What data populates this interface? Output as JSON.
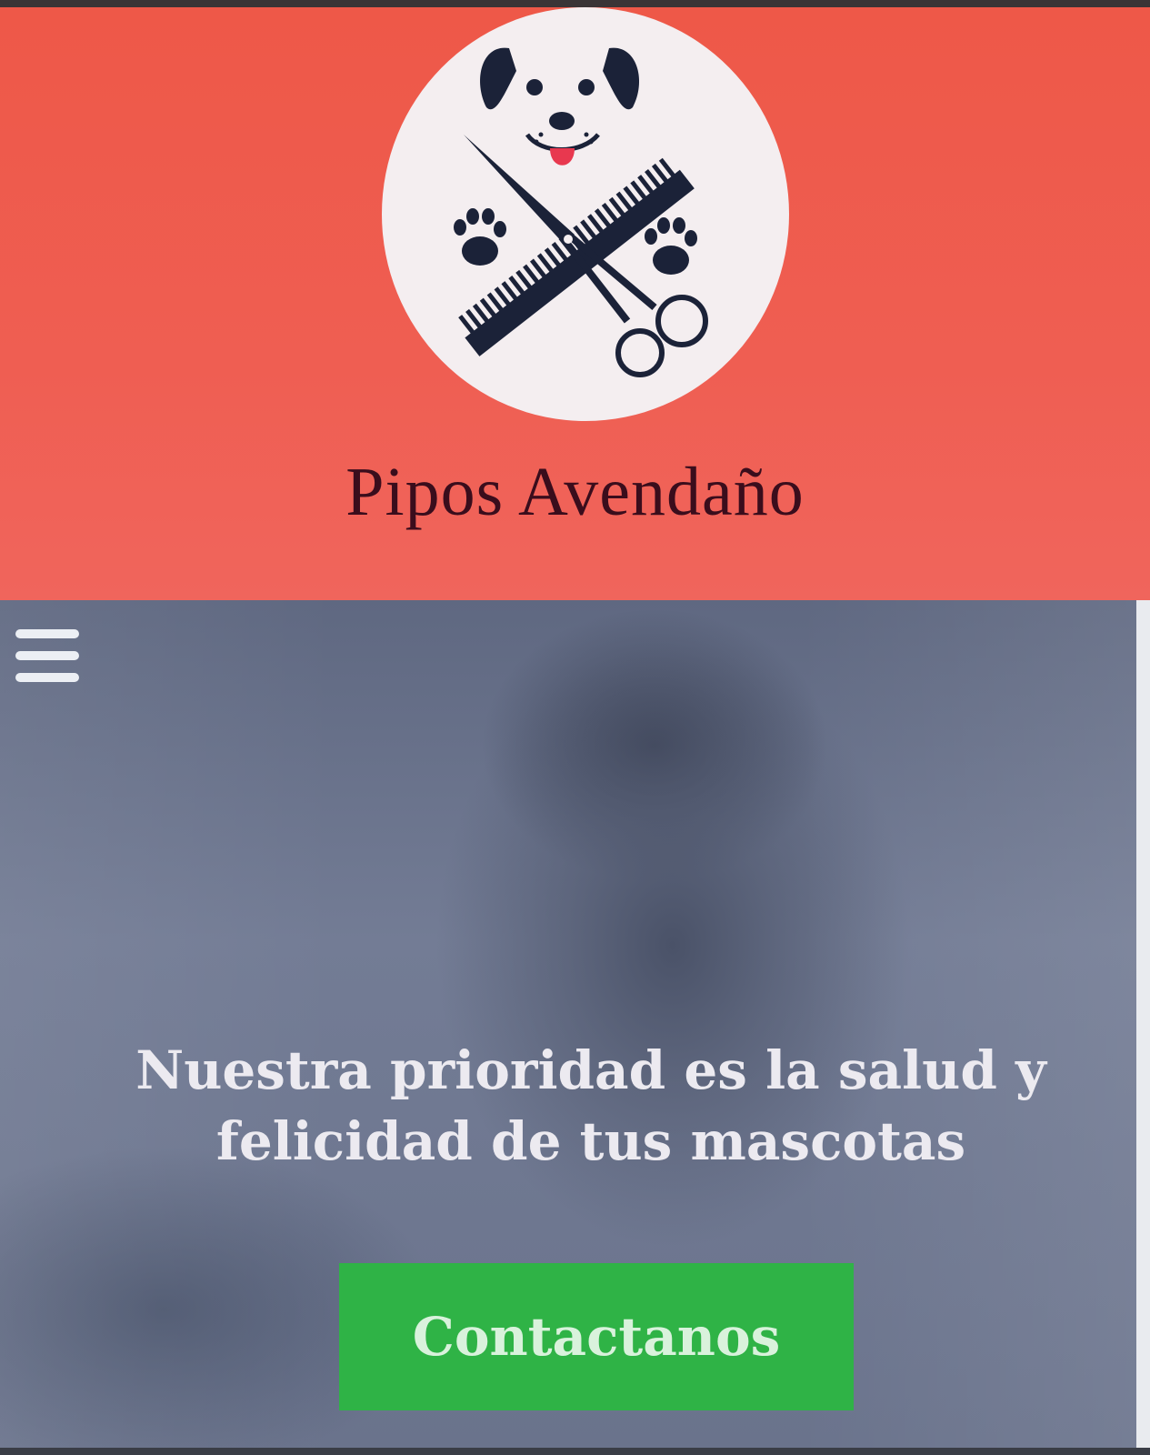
{
  "header": {
    "title": "Pipos Avendaño",
    "background_color": "#ee5848",
    "logo": {
      "name": "dog-grooming-logo",
      "icons": [
        "dog-face-icon",
        "scissors-icon",
        "comb-icon",
        "paw-icon"
      ]
    }
  },
  "hero": {
    "menu_icon": "hamburger-menu-icon",
    "headline": "Nuestra prioridad es la salud y felicidad de tus mascotas",
    "cta_label": "Contactanos",
    "cta_color": "#2fb346"
  }
}
